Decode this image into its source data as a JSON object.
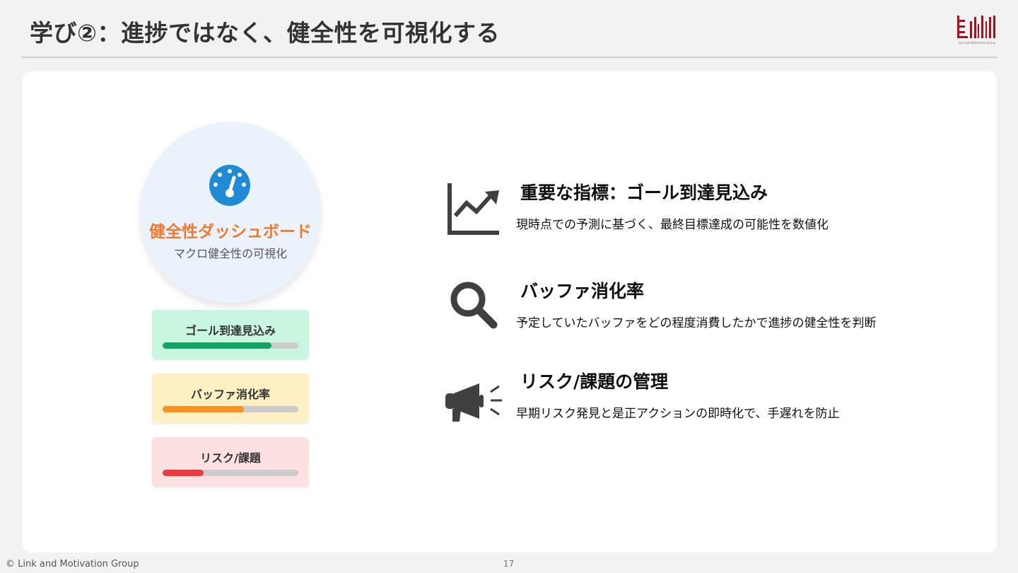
{
  "header": {
    "title": "学び②：進捗ではなく、健全性を可視化する",
    "logo_caption": "Link and Motivation Group"
  },
  "dashboard": {
    "title": "健全性ダッシュボード",
    "subtitle": "マクロ健全性の可視化",
    "icon": "gauge-icon",
    "metrics": [
      {
        "label": "ゴール到達見込み",
        "progress": 0.8,
        "bg": "#c9f6de",
        "color": "#0fa365"
      },
      {
        "label": "バッファ消化率",
        "progress": 0.6,
        "bg": "#fdf0c3",
        "color": "#fa9122"
      },
      {
        "label": "リスク/課題",
        "progress": 0.3,
        "bg": "#fde0e0",
        "color": "#ee3a3e"
      }
    ]
  },
  "items": [
    {
      "icon": "trend-chart-icon",
      "heading": "重要な指標：ゴール到達見込み",
      "description": "現時点での予測に基づく、最終目標達成の可能性を数値化"
    },
    {
      "icon": "search-icon",
      "heading": "バッファ消化率",
      "description": "予定していたバッファをどの程度消費したかで進捗の健全性を判断"
    },
    {
      "icon": "megaphone-icon",
      "heading": "リスク/課題の管理",
      "description": "早期リスク発見と是正アクションの即時化で、手遅れを防止"
    }
  ],
  "footer": {
    "copyright": "© Link and Motivation Group",
    "page_number": "17"
  },
  "colors": {
    "accent": "#f07a30",
    "icon_blue": "#1f8ad6",
    "icon_gray": "#404040",
    "logo_red": "#a8101c"
  }
}
